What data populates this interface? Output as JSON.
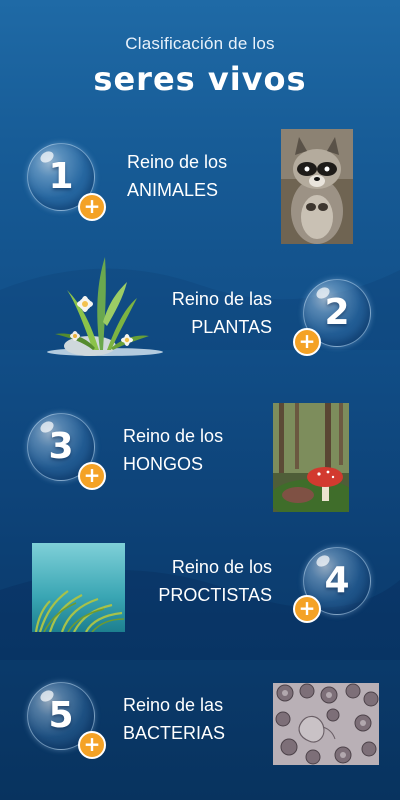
{
  "header": {
    "subtitle": "Clasificación de los",
    "title": "seres vivos"
  },
  "kingdoms": [
    {
      "number": "1",
      "line1": "Reino de los",
      "line2": "ANIMALES",
      "image": "raccoon-photo"
    },
    {
      "number": "2",
      "line1": "Reino de las",
      "line2": "PLANTAS",
      "image": "plants-illustration"
    },
    {
      "number": "3",
      "line1": "Reino de los",
      "line2": "HONGOS",
      "image": "mushroom-photo"
    },
    {
      "number": "4",
      "line1": "Reino de los",
      "line2": "PROCTISTAS",
      "image": "algae-photo"
    },
    {
      "number": "5",
      "line1": "Reino de las",
      "line2": "BACTERIAS",
      "image": "bacteria-micrograph"
    }
  ],
  "colors": {
    "background_top": "#1f6aa6",
    "background_bottom": "#08335f",
    "plus_button": "#f4a226"
  },
  "icons": {
    "plus": "plus-icon"
  }
}
